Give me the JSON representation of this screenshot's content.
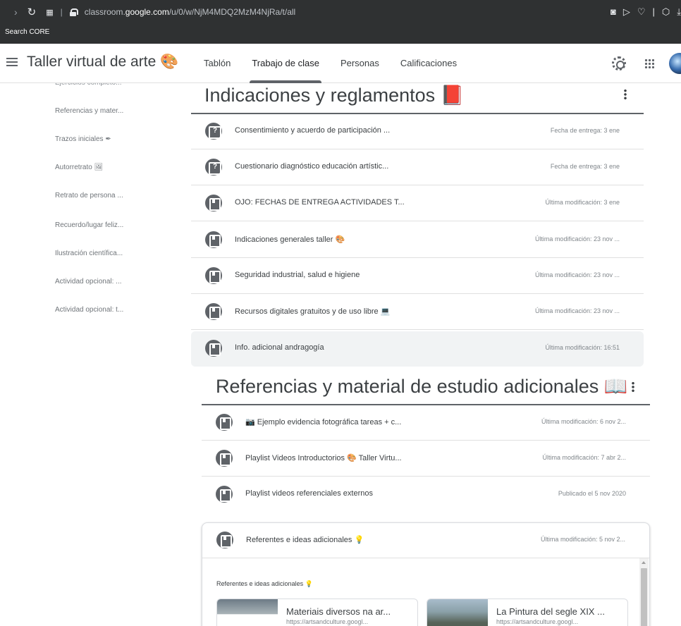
{
  "browser": {
    "url_prefix": "classroom.",
    "url_domain": "google.com",
    "url_path": "/u/0/w/NjM4MDQ2MzM4NjRa/t/all",
    "extension_label": "Search CORE"
  },
  "header": {
    "class_title": "Taller virtual de arte 🎨",
    "tabs": [
      {
        "label": "Tablón"
      },
      {
        "label": "Trabajo de clase"
      },
      {
        "label": "Personas"
      },
      {
        "label": "Calificaciones"
      }
    ],
    "active_tab": "Trabajo de clase"
  },
  "sidebar": {
    "cut_item": "Ejercicios completo...",
    "items": [
      {
        "label": "Referencias y mater..."
      },
      {
        "label": "Trazos iniciales ✒"
      },
      {
        "label": "Autorretrato 🖼"
      },
      {
        "label": "Retrato de persona ..."
      },
      {
        "label": "Recuerdo/lugar feliz..."
      },
      {
        "label": "Ilustración científica..."
      },
      {
        "label": "Actividad opcional: ..."
      },
      {
        "label": "Actividad opcional: t..."
      }
    ]
  },
  "section1": {
    "title": "Indicaciones y reglamentos 📕",
    "items": [
      {
        "title": "Consentimiento y acuerdo de participación ...",
        "meta": "Fecha de entrega: 3 ene",
        "type": "question"
      },
      {
        "title": "Cuestionario diagnóstico educación artístic...",
        "meta": "Fecha de entrega: 3 ene",
        "type": "question"
      },
      {
        "title": "OJO: FECHAS DE ENTREGA ACTIVIDADES T...",
        "meta": "Última modificación: 3 ene",
        "type": "material"
      },
      {
        "title": "Indicaciones generales taller 🎨",
        "meta": "Última modificación: 23 nov ...",
        "type": "material"
      },
      {
        "title": "Seguridad industrial, salud e higiene",
        "meta": "Última modificación: 23 nov ...",
        "type": "material"
      },
      {
        "title": "Recursos digitales gratuitos y de uso libre 💻",
        "meta": "Última modificación: 23 nov ...",
        "type": "material"
      },
      {
        "title": "Info. adicional andragogía",
        "meta": "Última modificación: 16:51",
        "type": "material"
      }
    ]
  },
  "section2": {
    "title": "Referencias y material de estudio adicionales 📖",
    "items": [
      {
        "title": "📷 Ejemplo evidencia fotográfica tareas + c...",
        "meta": "Última modificación: 6 nov 2..."
      },
      {
        "title": "Playlist Videos Introductorios 🎨 Taller Virtu...",
        "meta": "Última modificación: 7 abr 2..."
      },
      {
        "title": "Playlist videos referenciales externos",
        "meta": "Publicado el 5 nov 2020"
      }
    ],
    "expanded": {
      "title": "Referentes e ideas adicionales 💡",
      "meta": "Última modificación: 5 nov 2...",
      "description": "Referentes e ideas adicionales 💡",
      "attachments": [
        {
          "title": "Materiais diversos na ar...",
          "url": "https://artsandculture.googl..."
        },
        {
          "title": "La Pintura del segle XIX ...",
          "url": "https://artsandculture.googl..."
        }
      ]
    }
  },
  "colors": {
    "chrome_bg": "#2f3132",
    "icon_grey": "#5f6368",
    "text": "#3c4043",
    "highlight_row": "#f1f3f4"
  }
}
